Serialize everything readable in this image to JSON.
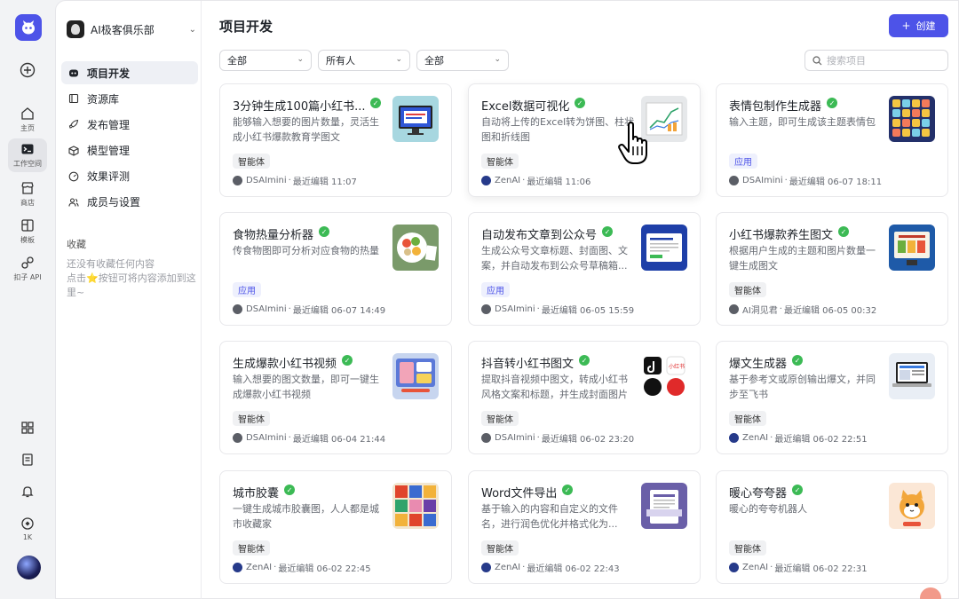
{
  "rail": {
    "items": [
      {
        "name": "create-icon",
        "label": ""
      },
      {
        "name": "home-icon",
        "label": "主页"
      },
      {
        "name": "workspace-icon",
        "label": "工作空间"
      },
      {
        "name": "store-icon",
        "label": "商店"
      },
      {
        "name": "template-icon",
        "label": "模板"
      },
      {
        "name": "api-icon",
        "label": "扣子 API"
      }
    ],
    "bottom": [
      {
        "name": "apps-icon",
        "label": ""
      },
      {
        "name": "docs-icon",
        "label": ""
      },
      {
        "name": "bell-icon",
        "label": ""
      },
      {
        "name": "credit-icon",
        "label": "1K"
      }
    ]
  },
  "sidebar": {
    "team_name": "AI极客俱乐部",
    "menu": [
      {
        "label": "项目开发",
        "icon": "bot-icon",
        "active": true
      },
      {
        "label": "资源库",
        "icon": "library-icon"
      },
      {
        "label": "发布管理",
        "icon": "rocket-icon"
      },
      {
        "label": "模型管理",
        "icon": "cube-icon"
      },
      {
        "label": "效果评测",
        "icon": "gauge-icon"
      },
      {
        "label": "成员与设置",
        "icon": "users-icon"
      }
    ],
    "favorites_title": "收藏",
    "favorites_empty_line1": "还没有收藏任何内容",
    "favorites_empty_line2a": "点击",
    "favorites_empty_line2b": "按钮可将内容添加到这里~"
  },
  "header": {
    "title": "项目开发",
    "create_label": "创建"
  },
  "filters": {
    "type": "全部",
    "owner": "所有人",
    "status": "全部",
    "search_placeholder": "搜索项目"
  },
  "colors": {
    "accent": "#4d53e8",
    "verified": "#3cba55"
  },
  "cards": [
    {
      "title": "3分钟生成100篇小红书...",
      "desc": "能够输入想要的图片数量，灵活生成小红书爆款教育学图文",
      "tag": "智能体",
      "tag_type": "agent",
      "author": "DSAImini",
      "edited": "最近编辑 11:07",
      "thumb": "monitor-thumb"
    },
    {
      "title": "Excel数据可视化",
      "desc": "自动将上传的Excel转为饼图、柱状图和折线图",
      "tag": "智能体",
      "tag_type": "agent",
      "author": "ZenAI",
      "edited": "最近编辑 11:06",
      "thumb": "chart-thumb"
    },
    {
      "title": "表情包制作生成器",
      "desc": "输入主题，即可生成该主题表情包",
      "tag": "应用",
      "tag_type": "app",
      "author": "DSAImini",
      "edited": "最近编辑 06-07 18:11",
      "thumb": "emoji-grid-thumb"
    },
    {
      "title": "食物热量分析器",
      "desc": "传食物图即可分析对应食物的热量",
      "tag": "应用",
      "tag_type": "app",
      "author": "DSAImini",
      "edited": "最近编辑 06-07 14:49",
      "thumb": "food-thumb"
    },
    {
      "title": "自动发布文章到公众号",
      "desc": "生成公众号文章标题、封面图、文案，并自动发布到公众号草稿箱...",
      "tag": "应用",
      "tag_type": "app",
      "author": "DSAImini",
      "edited": "最近编辑 06-05 15:59",
      "thumb": "article-thumb"
    },
    {
      "title": "小红书爆款养生图文",
      "desc": "根据用户生成的主题和图片数量一键生成图文",
      "tag": "智能体",
      "tag_type": "agent",
      "author": "AI洞见君",
      "edited": "最近编辑 06-05 00:32",
      "thumb": "health-thumb"
    },
    {
      "title": "生成爆款小红书视频",
      "desc": "输入想要的图文数量，即可一键生成爆款小红书视频",
      "tag": "智能体",
      "tag_type": "agent",
      "author": "DSAImini",
      "edited": "最近编辑 06-04 21:44",
      "thumb": "video-thumb"
    },
    {
      "title": "抖音转小红书图文",
      "desc": "提取抖音视频中图文，转成小红书风格文案和标题，并生成封面图片",
      "tag": "智能体",
      "tag_type": "agent",
      "author": "DSAImini",
      "edited": "最近编辑 06-02 23:20",
      "thumb": "douyin-thumb"
    },
    {
      "title": "爆文生成器",
      "desc": "基于参考文或原创输出爆文，并同步至飞书",
      "tag": "智能体",
      "tag_type": "agent",
      "author": "ZenAI",
      "edited": "最近编辑 06-02 22:51",
      "thumb": "laptop-thumb"
    },
    {
      "title": "城市胶囊",
      "desc": "一键生成城市胶囊图，人人都是城市收藏家",
      "tag": "智能体",
      "tag_type": "agent",
      "author": "ZenAI",
      "edited": "最近编辑 06-02 22:45",
      "thumb": "city-thumb"
    },
    {
      "title": "Word文件导出",
      "desc": "基于输入的内容和自定义的文件名，进行润色优化并格式化为...",
      "tag": "智能体",
      "tag_type": "agent",
      "author": "ZenAI",
      "edited": "最近编辑 06-02 22:43",
      "thumb": "word-thumb"
    },
    {
      "title": "暖心夸夸器",
      "desc": "暖心的夸夸机器人",
      "tag": "智能体",
      "tag_type": "agent",
      "author": "ZenAI",
      "edited": "最近编辑 06-02 22:31",
      "thumb": "cat-thumb"
    }
  ]
}
